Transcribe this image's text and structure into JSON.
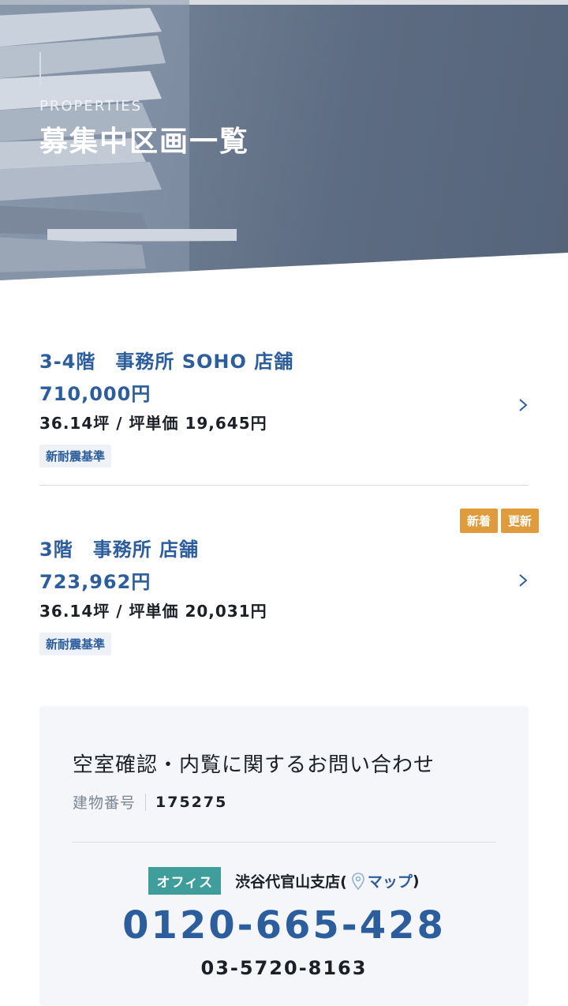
{
  "hero": {
    "eyebrow": "PROPERTIES",
    "title": "募集中区画一覧"
  },
  "properties": [
    {
      "name": "3-4階　事務所 SOHO 店舗",
      "price": "710,000円",
      "area": "36.14坪 / 坪単価 19,645円",
      "tag": "新耐震基準",
      "badges": []
    },
    {
      "name": "3階　事務所 店舗",
      "price": "723,962円",
      "area": "36.14坪 / 坪単価 20,031円",
      "tag": "新耐震基準",
      "badges": [
        "新着",
        "更新"
      ]
    }
  ],
  "contact": {
    "heading": "空室確認・内覧に関するお問い合わせ",
    "building_label": "建物番号",
    "building_number": "175275",
    "office_tag": "オフィス",
    "branch": "渋谷代官山支店(",
    "map_label": "マップ",
    "branch_close": ")",
    "phone_free": "0120-665-428",
    "phone": "03-5720-8163"
  },
  "colors": {
    "accent": "#2c5d9c",
    "badge": "#e09b3d",
    "office_tag": "#3f9e9b"
  },
  "icons": {
    "chevron": "chevron-right-icon",
    "map": "map-pin-icon"
  }
}
